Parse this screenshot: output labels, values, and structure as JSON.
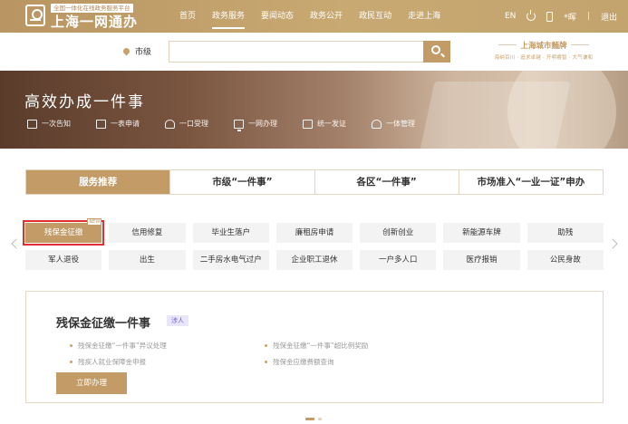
{
  "colors": {
    "brand": "#c29b66",
    "selected_outline": "#e03030",
    "tag_bg": "#e9e6fb",
    "tag_text": "#6d63c9"
  },
  "header": {
    "logo_tag": "全国一体化在线政务服务平台",
    "logo_title": "上海一网通办",
    "nav": [
      "首页",
      "政务服务",
      "要闻动态",
      "政务公开",
      "政民互动",
      "走进上海"
    ],
    "active_nav": "政务服务",
    "lang": "EN",
    "user": "*晖",
    "logout": "退出",
    "separator": "|"
  },
  "search": {
    "location": "市级",
    "placeholder": "",
    "brand_title": "上海城市麵牌",
    "brand_subtitle": "海纳百川 · 追求卓越 · 开明睿智 · 大气谦和"
  },
  "banner": {
    "title": "高效办成一件事",
    "steps": [
      {
        "icon": "envelope-icon",
        "label": "一次告知"
      },
      {
        "icon": "form-icon",
        "label": "一表申请"
      },
      {
        "icon": "user-icon",
        "label": "一口受理"
      },
      {
        "icon": "monitor-icon",
        "label": "一网办理"
      },
      {
        "icon": "certificate-icon",
        "label": "统一发证"
      },
      {
        "icon": "manage-icon",
        "label": "一体管理"
      }
    ]
  },
  "tabs": [
    "服务推荐",
    "市级“一件事”",
    "各区“一件事”",
    "市场准入“一业一证”申办"
  ],
  "active_tab": 0,
  "items": [
    "残保金征缴",
    "信用修复",
    "毕业生落户",
    "廉租房申请",
    "创新创业",
    "新能源车牌",
    "助残",
    "军人退役",
    "出生",
    "二手房水电气过户",
    "企业职工退休",
    "一户多人口",
    "医疗报销",
    "公民身故"
  ],
  "selected_item": 0,
  "selected_badge": "NEW",
  "detail": {
    "title": "残保金征缴一件事",
    "tag": "涉人",
    "links": [
      "残保金征缴“一件事”异议处理",
      "残保金征缴“一件事”超比例奖励",
      "残疾人就业保障金申报",
      "残保金应缴费额查询"
    ],
    "button": "立即办理"
  },
  "pager": {
    "active": 0,
    "total": 2
  }
}
